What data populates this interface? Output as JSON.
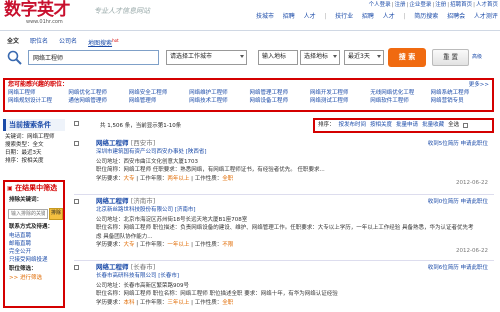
{
  "header": {
    "logo_text": "数字英才",
    "logo_url": "www.01hr.com",
    "slogan": "专业人才信息网站",
    "topnav": [
      "个人登录",
      "注册",
      "企业登录",
      "注册",
      "招聘首页",
      "人才首页"
    ],
    "mainnav": [
      "技城市",
      "招聘",
      "人才",
      "技行业",
      "招聘",
      "人才",
      "简历搜索",
      "招聘会",
      "人才测评"
    ]
  },
  "search": {
    "tabs": [
      "全文",
      "职位名",
      "公司名",
      "地图搜索"
    ],
    "hot_badge": "hot",
    "keyword": "网络工程师",
    "city": "请选择工作城市",
    "location": "输入地标",
    "type": "选择地标",
    "date": "最近3天",
    "search_btn": "搜 索",
    "reset_btn": "重 置",
    "advanced": "高级"
  },
  "interest": {
    "title": "您可能感兴趣的职位：",
    "more": "更多>>",
    "items": [
      "网络工程师",
      "网络优化工程师",
      "网络安全工程师",
      "网络维护工程师",
      "网络管理工程师",
      "网络开发工程师",
      "无线网络优化工程",
      "网络系统工程师",
      "网络规划设计工程",
      "通信网络管理师",
      "网络管理师",
      "网络技术工程师",
      "网络设备工程师",
      "网络测试工程师",
      "网络软件工程师",
      "网络营销专员"
    ]
  },
  "left": {
    "cond_title": "当前搜索条件",
    "cond_tag": "收起",
    "conditions": [
      "关键词：网络工程师",
      "搜索类型：全文",
      "日期：最近3天",
      "排序：按相关度"
    ],
    "filter_title": "在结果中筛选",
    "exclude_label": "排除关键词：",
    "exclude_placeholder": "输入排除的关键词",
    "exclude_btn": "排除",
    "contact_label": "联系方式及待遇：",
    "contact_items": [
      "电话直聘",
      "邮箱直聘",
      "完全公开",
      "只接受网络投递"
    ],
    "jobtype_label": "职位筛选：",
    "jobtype_link": ">> 进行筛选"
  },
  "results": {
    "count_text": "共 1,506 条，当前显示第1-10条",
    "toolbar": [
      "排序：",
      "按发布时间",
      "按相关度",
      "批量申请",
      "批量收藏",
      "全选"
    ],
    "jobs": [
      {
        "title": "网络工程师",
        "city": "[西安市]",
        "company": "深圳市建筑国有资产公司西安办事处 [陕西省]",
        "detail": "公司地址：西安市曲江文化创意大厦1703",
        "desc": "职位简称：网络工程师 任职要求：熟悉网络，有网络工程师证书，有经验者优先。 任职要求...",
        "meta_edu": "学历要求：",
        "meta_edu_v": "大专",
        "meta_exp": "工作年限：",
        "meta_exp_v": "两年以上",
        "meta_type": "工作性质：",
        "meta_type_v": "全职",
        "actions": "收到5位简历  申请此职位",
        "date": "2012-06-22"
      },
      {
        "title": "网络工程师",
        "city": "[济南市]",
        "company": "北京新丝路世科技股份有限公司 [济南市]",
        "detail": "公司地址：北京市海淀区苏州街18号长远天地大厦B1座708室",
        "desc": "职位名称：网络工程师 职位描述：负责网络设备的建设、维护、网络管理工作。任职要求：大专以上学历，一年以上工作经验 具备熟悉，华为认证者优先考虑 具备团队协作能力...",
        "meta_edu": "学历要求：",
        "meta_edu_v": "大专",
        "meta_exp": "工作年限：",
        "meta_exp_v": "一年以上",
        "meta_type": "工作性质：",
        "meta_type_v": "不限",
        "actions": "收到0位简历  申请此职位",
        "date": "2012-06-22"
      },
      {
        "title": "网络工程师",
        "city": "[长春市]",
        "company": "长春市高研科技有限公司 [长春市]",
        "detail": "公司地址：长春市高新区繁荣路909号",
        "desc": "职位名称：网络工程师 职位名称：网络工程师 职位描述全职 要求：网络十年，有华为网络认证经验",
        "meta_edu": "学历要求：",
        "meta_edu_v": "本科",
        "meta_exp": "工作年限：",
        "meta_exp_v": "三年以上",
        "meta_type": "工作性质：",
        "meta_type_v": "全职",
        "actions": "收到6位简历  申请此职位",
        "date": "2012-06-22"
      }
    ]
  },
  "colors": {
    "brand_red": "#c8102e",
    "highlight_red": "#d40000",
    "link_blue": "#1a4aa8",
    "search_orange": "#f06a10"
  }
}
